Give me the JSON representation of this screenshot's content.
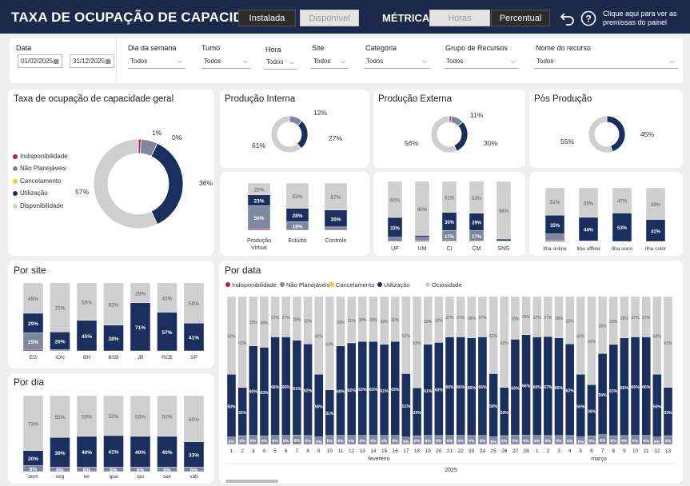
{
  "header": {
    "title": "TAXA DE OCUPAÇÃO DE CAPACIDADE",
    "toggle1": [
      "Instalada",
      "Disponível"
    ],
    "metrica_label": "MÉTRICA",
    "toggle2": [
      "Horas",
      "Percentual"
    ],
    "help_text": "Clique aqui para ver as premissas do painel"
  },
  "filters": {
    "data_label": "Data",
    "date_start": "01/02/2025",
    "date_end": "31/12/2025",
    "items": [
      {
        "label": "Dia da semana",
        "value": "Todos"
      },
      {
        "label": "Turno",
        "value": "Todos"
      },
      {
        "label": "Hora",
        "value": "Todos"
      },
      {
        "label": "Site",
        "value": "Todos"
      },
      {
        "label": "Categoria",
        "value": "Todos"
      },
      {
        "label": "Grupo de Recursos",
        "value": "Todos"
      },
      {
        "label": "Nome do recurso",
        "value": "Todos"
      }
    ]
  },
  "colors": {
    "indisp": "#c2185b",
    "naoplan": "#7d88a0",
    "cancel": "#f2d21b",
    "util": "#1b2f5e",
    "disp": "#cfcfcf",
    "header": "#1b2a4a"
  },
  "geral": {
    "title": "Taxa de ocupação de capacidade geral",
    "legend": [
      "Indisponibilidade",
      "Não Planejáveis",
      "Cancelamento",
      "Utilização",
      "Disponibilidade"
    ],
    "labels": [
      "1%",
      "0%",
      "36%",
      "57%"
    ]
  },
  "titles": {
    "interna": "Produção Interna",
    "externa": "Produção Externa",
    "pos": "Pós Produção",
    "site": "Por site",
    "dia": "Por dia",
    "data": "Por data"
  },
  "chart_data": [
    {
      "type": "pie",
      "name": "geral",
      "slices": [
        {
          "label": "Indisponibilidade",
          "value": 1
        },
        {
          "label": "Não Planejáveis",
          "value": 6
        },
        {
          "label": "Cancelamento",
          "value": 0
        },
        {
          "label": "Utilização",
          "value": 36
        },
        {
          "label": "Disponibilidade",
          "value": 57
        }
      ]
    },
    {
      "type": "pie",
      "name": "interna",
      "slices": [
        {
          "label": "Não Planejáveis",
          "value": 12
        },
        {
          "label": "Utilização",
          "value": 27
        },
        {
          "label": "Disponibilidade",
          "value": 61
        }
      ],
      "labels": [
        "12%",
        "27%",
        "61%"
      ]
    },
    {
      "type": "pie",
      "name": "externa",
      "slices": [
        {
          "label": "Indisponibilidade",
          "value": 2
        },
        {
          "label": "Não Planejáveis",
          "value": 11
        },
        {
          "label": "Utilização",
          "value": 30
        },
        {
          "label": "Disponibilidade",
          "value": 56
        }
      ],
      "labels": [
        "11%",
        "30%",
        "56%"
      ]
    },
    {
      "type": "pie",
      "name": "pos",
      "slices": [
        {
          "label": "Utilização",
          "value": 45
        },
        {
          "label": "Disponibilidade",
          "value": 55
        }
      ],
      "labels": [
        "45%",
        "55%"
      ]
    },
    {
      "type": "bar",
      "name": "interna_bars",
      "stacked": true,
      "categories": [
        "Produção Virtual",
        "Estúdio",
        "Controle"
      ],
      "series": [
        {
          "name": "Indisponibilidade",
          "values": [
            2,
            0,
            0
          ]
        },
        {
          "name": "Não Planejáveis",
          "values": [
            50,
            18,
            7
          ]
        },
        {
          "name": "Utilização",
          "values": [
            23,
            28,
            36
          ]
        },
        {
          "name": "Disponibilidade",
          "values": [
            25,
            53,
            57
          ]
        }
      ],
      "labels": {
        "Não Planejáveis": [
          "50%",
          "18%",
          ""
        ],
        "Utilização": [
          "23%",
          "28%",
          "36%"
        ],
        "Disponibilidade": [
          "25%",
          "53%",
          "57%"
        ]
      }
    },
    {
      "type": "bar",
      "name": "externa_bars",
      "stacked": true,
      "categories": [
        "UP",
        "UM",
        "CI",
        "CM",
        "SNG"
      ],
      "series": [
        {
          "name": "Indisponibilidade",
          "values": [
            0,
            2,
            1,
            1,
            0
          ]
        },
        {
          "name": "Não Planejáveis",
          "values": [
            7,
            5,
            17,
            17,
            1
          ]
        },
        {
          "name": "Utilização",
          "values": [
            33,
            3,
            30,
            29,
            3
          ]
        },
        {
          "name": "Disponibilidade",
          "values": [
            60,
            90,
            51,
            53,
            96
          ]
        }
      ],
      "labels": {
        "Não Planejáveis": [
          "",
          "",
          "17%",
          "17%",
          ""
        ],
        "Utilização": [
          "33%",
          "",
          "30%",
          "29%",
          ""
        ],
        "Disponibilidade": [
          "60%",
          "90%",
          "51%",
          "53%",
          "96%"
        ]
      }
    },
    {
      "type": "bar",
      "name": "pos_bars",
      "stacked": true,
      "categories": [
        "Ilha online",
        "Ilha offline",
        "Ilha sono",
        "Ilha color"
      ],
      "series": [
        {
          "name": "Indisponibilidade",
          "values": [
            2,
            0,
            0,
            0
          ]
        },
        {
          "name": "Não Planejáveis",
          "values": [
            12,
            1,
            0,
            0
          ]
        },
        {
          "name": "Utilização",
          "values": [
            35,
            44,
            53,
            41
          ]
        },
        {
          "name": "Disponibilidade",
          "values": [
            51,
            55,
            47,
            59
          ]
        }
      ],
      "labels": {
        "Utilização": [
          "35%",
          "44%",
          "53%",
          "41%"
        ],
        "Disponibilidade": [
          "51%",
          "55%",
          "47%",
          "59%"
        ]
      }
    },
    {
      "type": "bar",
      "name": "site",
      "stacked": true,
      "categories": [
        "EG",
        "ION",
        "BH",
        "BSB",
        "JB",
        "RCE",
        "SP"
      ],
      "series": [
        {
          "name": "Indisponibilidade",
          "values": [
            2,
            0,
            0,
            0,
            0,
            0,
            0
          ]
        },
        {
          "name": "Não Planejáveis",
          "values": [
            25,
            2,
            0,
            0,
            0,
            0,
            0
          ]
        },
        {
          "name": "Utilização",
          "values": [
            29,
            26,
            45,
            38,
            71,
            57,
            41
          ]
        },
        {
          "name": "Ociosidade",
          "values": [
            45,
            72,
            55,
            62,
            29,
            43,
            59
          ]
        }
      ],
      "labels": {
        "Não Planejáveis": [
          "25%",
          "",
          "",
          "",
          "",
          "",
          ""
        ],
        "Utilização": [
          "29%",
          "26%",
          "45%",
          "38%",
          "71%",
          "57%",
          "41%"
        ],
        "Ociosidade": [
          "45%",
          "72%",
          "55%",
          "62%",
          "29%",
          "43%",
          "59%"
        ]
      }
    },
    {
      "type": "bar",
      "name": "dia",
      "stacked": true,
      "categories": [
        "dom",
        "seg",
        "ter",
        "qua",
        "qui",
        "sex",
        "sáb"
      ],
      "series": [
        {
          "name": "Não Planejáveis",
          "values": [
            8,
            6,
            6,
            6,
            6,
            6,
            6
          ]
        },
        {
          "name": "Utilização",
          "values": [
            20,
            39,
            40,
            41,
            40,
            40,
            33
          ]
        },
        {
          "name": "Ociosidade",
          "values": [
            73,
            55,
            53,
            52,
            53,
            53,
            60
          ]
        }
      ],
      "labels": {
        "Não Planejáveis": [
          "8%",
          "6%",
          "6%",
          "6%",
          "6%",
          "6%",
          "6%"
        ],
        "Utilização": [
          "20%",
          "39%",
          "40%",
          "41%",
          "40%",
          "40%",
          "33%"
        ],
        "Ociosidade": [
          "73%",
          "55%",
          "53%",
          "52%",
          "53%",
          "53%",
          "60%"
        ]
      }
    },
    {
      "type": "bar",
      "name": "data",
      "stacked": true,
      "legend": [
        "Indisponibilidade",
        "Não Planejáveis",
        "Cancelamento",
        "Utilização",
        "Ociosidade"
      ],
      "categories": [
        "1",
        "2",
        "3",
        "4",
        "5",
        "6",
        "7",
        "8",
        "9",
        "10",
        "11",
        "12",
        "13",
        "14",
        "15",
        "16",
        "17",
        "18",
        "19",
        "20",
        "21",
        "22",
        "23",
        "24",
        "25",
        "26",
        "27",
        "28",
        "1",
        "2",
        "3",
        "4",
        "5",
        "6",
        "7",
        "8",
        "9",
        "10",
        "11",
        "12",
        "13"
      ],
      "month_labels": [
        "fevereiro",
        "março"
      ],
      "year_label": "2025",
      "series": [
        {
          "name": "Não Planejáveis",
          "values": [
            6,
            6,
            6,
            6,
            6,
            6,
            6,
            6,
            6,
            6,
            6,
            6,
            6,
            6,
            6,
            6,
            6,
            6,
            6,
            6,
            6,
            6,
            6,
            6,
            6,
            6,
            6,
            6,
            6,
            6,
            6,
            6,
            6,
            6,
            6,
            6,
            6,
            6,
            6,
            6,
            6
          ]
        },
        {
          "name": "Utilização",
          "values": [
            50,
            33,
            60,
            63,
            66,
            66,
            61,
            62,
            50,
            31,
            60,
            62,
            63,
            63,
            61,
            63,
            51,
            33,
            61,
            63,
            66,
            66,
            66,
            66,
            50,
            33,
            63,
            66,
            66,
            67,
            66,
            62,
            50,
            36,
            50,
            63,
            66,
            66,
            66,
            50,
            33
          ]
        },
        {
          "name": "Ociosidade",
          "values": [
            62,
            62,
            33,
            36,
            27,
            27,
            28,
            32,
            62,
            63,
            33,
            31,
            30,
            30,
            32,
            30,
            62,
            63,
            32,
            31,
            27,
            27,
            28,
            27,
            61,
            62,
            28,
            25,
            27,
            27,
            28,
            32,
            62,
            62,
            35,
            33,
            28,
            27,
            27,
            62,
            62
          ]
        }
      ],
      "labels": {
        "Não Planejáveis": [
          "6%",
          "6%",
          "6%",
          "6%",
          "6%",
          "6%",
          "6%",
          "6%",
          "6%",
          "6%",
          "6%",
          "6%",
          "6%",
          "6%",
          "6%",
          "6%",
          "6%",
          "6%",
          "6%",
          "6%",
          "6%",
          "6%",
          "6%",
          "6%",
          "6%",
          "6%",
          "6%",
          "6%",
          "6%",
          "6%",
          "6%",
          "6%",
          "6%",
          "6%",
          "6%",
          "6%",
          "6%",
          "6%",
          "6%",
          "6%",
          "6%"
        ],
        "Utilização": [
          "50%",
          "33%",
          "60%",
          "63%",
          "66%",
          "66%",
          "61%",
          "62%",
          "50%",
          "31%",
          "60%",
          "62%",
          "63%",
          "63%",
          "61%",
          "63%",
          "51%",
          "33%",
          "61%",
          "63%",
          "66%",
          "66%",
          "66%",
          "66%",
          "50%",
          "33%",
          "63%",
          "66%",
          "66%",
          "67%",
          "66%",
          "62%",
          "50%",
          "36%",
          "50%",
          "63%",
          "66%",
          "66%",
          "66%",
          "50%",
          "33%"
        ],
        "Ociosidade": [
          "62%",
          "62%",
          "33%",
          "36%",
          "27%",
          "27%",
          "28%",
          "32%",
          "62%",
          "63%",
          "33%",
          "31%",
          "30%",
          "30%",
          "32%",
          "30%",
          "62%",
          "63%",
          "32%",
          "31%",
          "27%",
          "27%",
          "28%",
          "27%",
          "61%",
          "62%",
          "28%",
          "25%",
          "27%",
          "27%",
          "28%",
          "32%",
          "62%",
          "62%",
          "35%",
          "33%",
          "28%",
          "27%",
          "27%",
          "62%",
          "62%"
        ]
      }
    }
  ]
}
